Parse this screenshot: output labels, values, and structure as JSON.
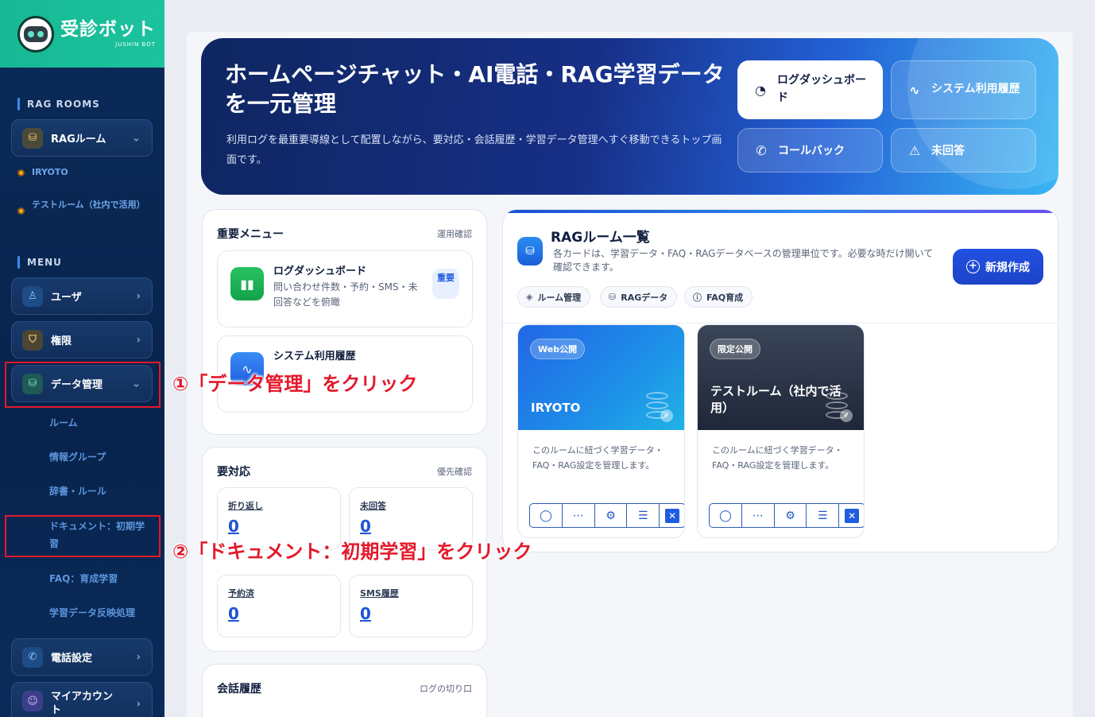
{
  "brand": {
    "name": "受診ボット",
    "sub": "JUSHIN BOT"
  },
  "sidebar": {
    "rag_rooms_label": "RAG ROOMS",
    "rag_room_select": "RAGルーム",
    "rooms": [
      "IRYOTO",
      "テストルーム（社内で活用）"
    ],
    "menu_label": "MENU",
    "items": {
      "users": "ユーザ",
      "permissions": "権限",
      "data_management": "データ管理",
      "phone_settings": "電話設定",
      "my_account": "マイアカウント"
    },
    "data_sub": [
      "ルーム",
      "情報グループ",
      "辞書・ルール",
      "ドキュメント：初期学習",
      "FAQ：育成学習",
      "学習データ反映処理"
    ]
  },
  "hero": {
    "title": "ホームページチャット・AI電話・RAG学習データを一元管理",
    "description": "利用ログを最重要導線として配置しながら、要対応・会話履歴・学習データ管理へすぐ移動できるトップ画面です。",
    "buttons": {
      "log_dashboard": "ログダッシュボード",
      "system_usage": "システム利用履歴",
      "callback": "コールバック",
      "unanswered": "未回答"
    }
  },
  "important_menu": {
    "title": "重要メニュー",
    "link": "運用確認",
    "items": [
      {
        "title": "ログダッシュボード",
        "desc": "問い合わせ件数・予約・SMS・未回答などを俯瞰",
        "badge": "重要"
      },
      {
        "title": "システム利用履歴",
        "desc": ""
      }
    ]
  },
  "action_required": {
    "title": "要対応",
    "link": "優先確認",
    "stats": [
      {
        "label": "折り返し",
        "value": "0"
      },
      {
        "label": "未回答",
        "value": "0"
      },
      {
        "label": "予約済",
        "value": "0"
      },
      {
        "label": "SMS履歴",
        "value": "0"
      }
    ]
  },
  "history": {
    "title": "会話履歴",
    "link": "ログの切り口"
  },
  "rag": {
    "title": "RAGルーム一覧",
    "desc": "各カードは、学習データ・FAQ・RAGデータベースの管理単位です。必要な時だけ開いて確認できます。",
    "new_button": "新規作成",
    "chips": [
      "ルーム管理",
      "RAGデータ",
      "FAQ育成"
    ],
    "rooms": [
      {
        "badge": "Web公開",
        "name": "IRYOTO",
        "desc": "このルームに紐づく学習データ・FAQ・RAG設定を管理します。"
      },
      {
        "badge": "限定公開",
        "name": "テストルーム（社内で活用）",
        "desc": "このルームに紐づく学習データ・FAQ・RAG設定を管理します。"
      }
    ]
  },
  "annotations": {
    "step1": "①「データ管理」をクリック",
    "step2": "②「ドキュメント：初期学習」をクリック"
  },
  "colors": {
    "brand_green": "#1cc39e",
    "sidebar_navy": "#0b2a58",
    "accent_blue": "#1f5ce0",
    "annotation_red": "#e3192a"
  }
}
